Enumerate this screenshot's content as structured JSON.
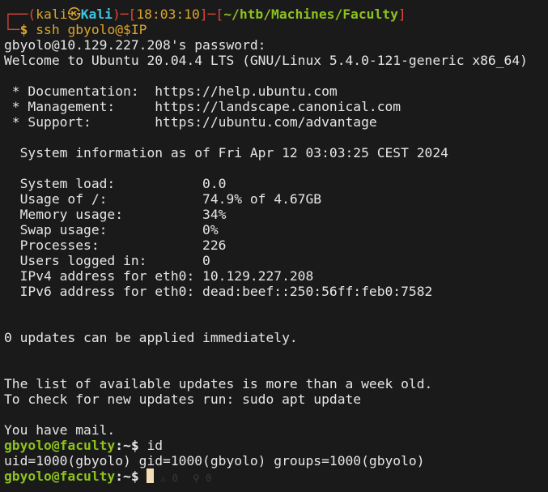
{
  "prompt1": {
    "user": "kali",
    "host": "Kali",
    "time": "18:03:10",
    "path": "~/htb/Machines/Faculty",
    "command": "ssh gbyolo@$IP"
  },
  "output": [
    "gbyolo@10.129.227.208's password:",
    "Welcome to Ubuntu 20.04.4 LTS (GNU/Linux 5.4.0-121-generic x86_64)",
    "",
    " * Documentation:  https://help.ubuntu.com",
    " * Management:     https://landscape.canonical.com",
    " * Support:        https://ubuntu.com/advantage",
    "",
    "  System information as of Fri Apr 12 03:03:25 CEST 2024",
    "",
    "  System load:           0.0",
    "  Usage of /:            74.9% of 4.67GB",
    "  Memory usage:          34%",
    "  Swap usage:            0%",
    "  Processes:             226",
    "  Users logged in:       0",
    "  IPv4 address for eth0: 10.129.227.208",
    "  IPv6 address for eth0: dead:beef::250:56ff:feb0:7582",
    "",
    "",
    "0 updates can be applied immediately.",
    "",
    "",
    "The list of available updates is more than a week old.",
    "To check for new updates run: sudo apt update",
    "",
    "You have mail."
  ],
  "remote_prompt": {
    "user_host": "gbyolo@faculty",
    "path": ":~$ ",
    "command": "id"
  },
  "id_output": "uid=1000(gbyolo) gid=1000(gbyolo) groups=1000(gbyolo)",
  "status_ghost": {
    "errors": "0",
    "warnings": "0"
  }
}
